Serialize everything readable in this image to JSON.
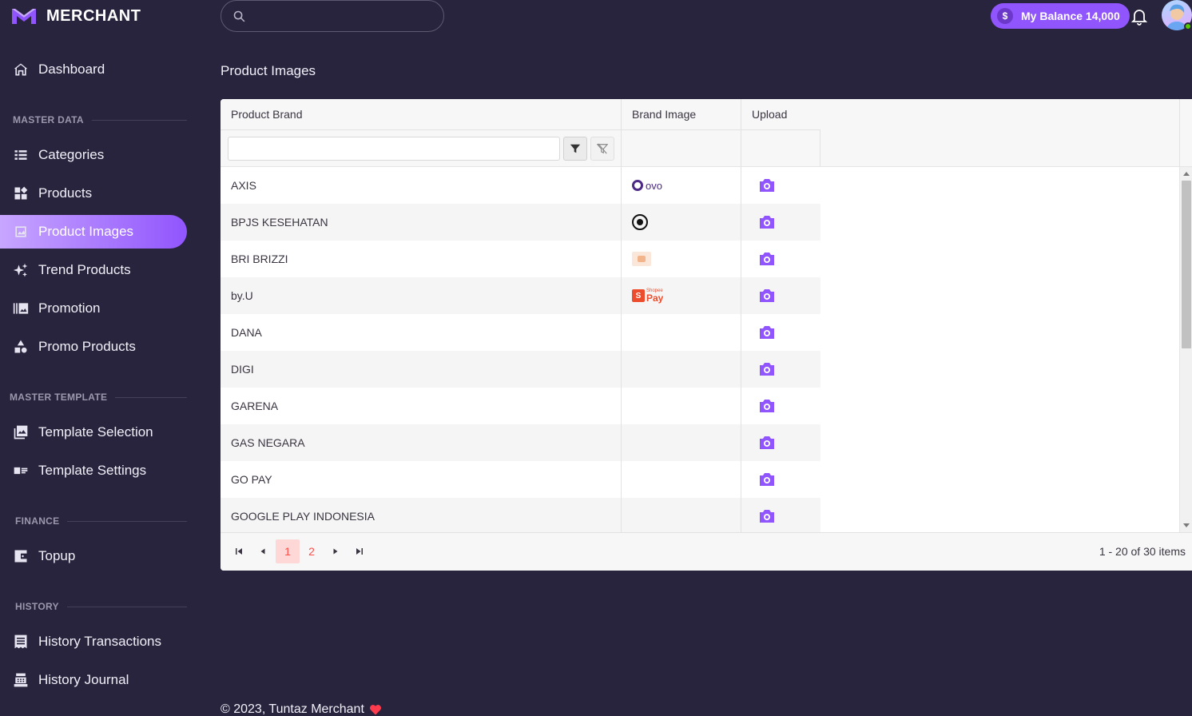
{
  "app": {
    "name": "MERCHANT"
  },
  "header": {
    "search_placeholder": "",
    "balance_label": "My Balance 14,000",
    "balance_symbol": "$"
  },
  "sidebar": {
    "dashboard": "Dashboard",
    "sections": {
      "master_data": "MASTER DATA",
      "master_template": "MASTER TEMPLATE",
      "finance": "FINANCE",
      "history": "HISTORY"
    },
    "items": {
      "categories": "Categories",
      "products": "Products",
      "product_images": "Product Images",
      "trend_products": "Trend Products",
      "promotion": "Promotion",
      "promo_products": "Promo Products",
      "template_selection": "Template Selection",
      "template_settings": "Template Settings",
      "topup": "Topup",
      "history_transactions": "History Transactions",
      "history_journal": "History Journal"
    },
    "active": "product_images"
  },
  "page": {
    "title": "Product Images"
  },
  "grid": {
    "columns": [
      "Product Brand",
      "Brand Image",
      "Upload"
    ],
    "rows": [
      {
        "brand": "AXIS",
        "image": "ovo-logo"
      },
      {
        "brand": "BPJS KESEHATAN",
        "image": "target-logo"
      },
      {
        "brand": "BRI BRIZZI",
        "image": "bri-logo"
      },
      {
        "brand": "by.U",
        "image": "shopeepay-logo"
      },
      {
        "brand": "DANA",
        "image": ""
      },
      {
        "brand": "DIGI",
        "image": ""
      },
      {
        "brand": "GARENA",
        "image": ""
      },
      {
        "brand": "GAS NEGARA",
        "image": ""
      },
      {
        "brand": "GO PAY",
        "image": ""
      },
      {
        "brand": "GOOGLE PLAY INDONESIA",
        "image": ""
      }
    ],
    "logo_text": {
      "ovo": "ovo",
      "shopee_small": "Shopee",
      "shopee_pay": "Pay",
      "shopee_bag": "S"
    },
    "pager": {
      "pages": [
        "1",
        "2"
      ],
      "current": "1",
      "info": "1 - 20 of 30 items"
    }
  },
  "footer": {
    "text": "© 2023, Tuntaz Merchant"
  },
  "colors": {
    "bg": "#29243d",
    "accent": "#9155fd",
    "active_page": "#ff4d49"
  }
}
